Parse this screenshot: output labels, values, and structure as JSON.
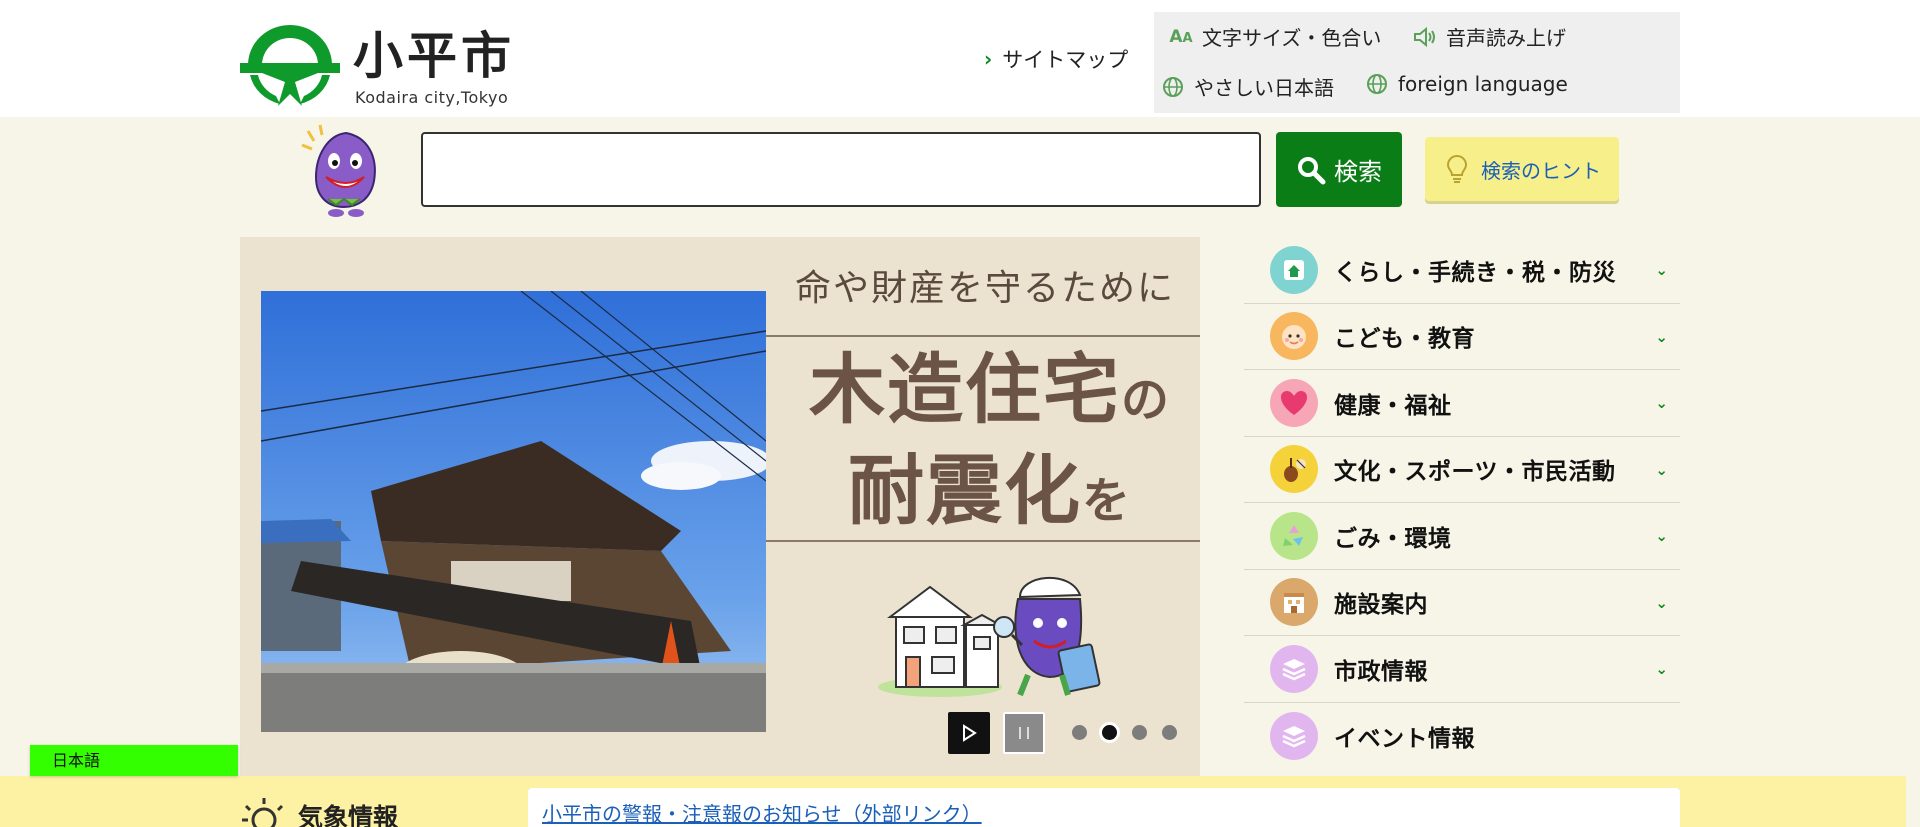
{
  "header": {
    "logo_name": "小平市",
    "logo_sub": "Kodaira city,Tokyo",
    "sitemap_label": "サイトマップ",
    "utilities": {
      "text_size_color": "文字サイズ・色合い",
      "read_aloud": "音声読み上げ",
      "easy_japanese": "やさしい日本語",
      "foreign_language": "foreign language"
    }
  },
  "search": {
    "value": "",
    "button_label": "検索",
    "hint_label": "検索のヒント"
  },
  "banner": {
    "lead": "命や財産を守るために",
    "main_a": "木造住宅",
    "main_a_suffix": "の",
    "main_b": "耐震化",
    "main_b_suffix": "を",
    "slides_total": 4,
    "active_slide": 2
  },
  "menu": [
    {
      "label": "くらし・手続き・税・防災",
      "icon": "house-icon",
      "color": "#7fd3d1",
      "expandable": true
    },
    {
      "label": "こども・教育",
      "icon": "baby-face-icon",
      "color": "#f8b75e",
      "expandable": true
    },
    {
      "label": "健康・福祉",
      "icon": "heart-icon",
      "color": "#f7a6b7",
      "expandable": true
    },
    {
      "label": "文化・スポーツ・市民活動",
      "icon": "violin-icon",
      "color": "#f5d13a",
      "expandable": true
    },
    {
      "label": "ごみ・環境",
      "icon": "recycle-icon",
      "color": "#b9e58a",
      "expandable": true
    },
    {
      "label": "施設案内",
      "icon": "building-icon",
      "color": "#d9a86a",
      "expandable": true
    },
    {
      "label": "市政情報",
      "icon": "layers-icon",
      "color": "#e1b6ef",
      "expandable": true
    },
    {
      "label": "イベント情報",
      "icon": "layers-icon",
      "color": "#e1b6ef",
      "expandable": false
    }
  ],
  "language_pill": "日本語",
  "weather": {
    "title": "気象情報",
    "link": "小平市の警報・注意報のお知らせ（外部リンク）"
  },
  "colors": {
    "brand_green": "#0b7d17",
    "band_bg": "#f7f5e8",
    "hint_yellow": "#f7f08a",
    "weather_bg": "#fdf2a4"
  }
}
